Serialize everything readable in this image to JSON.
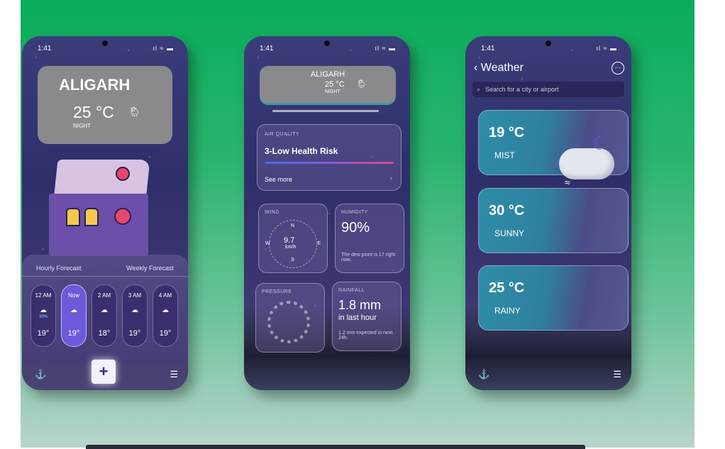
{
  "phone1": {
    "status": {
      "time": "1:41",
      "icons": "ıl ≈ ▬"
    },
    "card": {
      "city": "ALIGARH",
      "temp": "25 °C",
      "period": "NIGHT",
      "weather_icon": "🌦"
    },
    "forecast": {
      "tabs": [
        "Hourly Forecast",
        "Weekly Forecast"
      ],
      "hours": [
        {
          "label": "12 AM",
          "icon": "☁",
          "pct": "30%",
          "temp": "19°"
        },
        {
          "label": "Now",
          "icon": "☁",
          "pct": "",
          "temp": "19°"
        },
        {
          "label": "2 AM",
          "icon": "☁",
          "pct": "",
          "temp": "18°"
        },
        {
          "label": "3 AM",
          "icon": "☁",
          "pct": "",
          "temp": "19°"
        },
        {
          "label": "4 AM",
          "icon": "☁",
          "pct": "",
          "temp": "19°"
        }
      ]
    },
    "tabbar": {
      "left_icon": "⚓",
      "add_label": "+",
      "right_icon": "☰"
    }
  },
  "phone2": {
    "status": {
      "time": "1:41",
      "icons": "ıl ≈ ▬"
    },
    "card": {
      "city": "ALIGARH",
      "temp": "25 °C",
      "period": "NIGHT",
      "weather_icon": "🌦"
    },
    "air_quality": {
      "label": "AIR QUALITY",
      "value": "3-Low Health Risk",
      "more": "See more",
      "chevron": "›"
    },
    "wind": {
      "label": "WIND",
      "speed": "9.7",
      "unit": "km/h",
      "n": "N",
      "s": "S",
      "e": "E",
      "w": "W"
    },
    "humidity": {
      "label": "HUMIDITY",
      "value": "90%",
      "desc": "The dew point is 17 right now."
    },
    "pressure": {
      "label": "PRESSURE"
    },
    "rainfall": {
      "label": "RAINFALL",
      "value": "1.8 mm",
      "sub": "in last hour",
      "desc": "1.2 mm expected in next 24h."
    }
  },
  "phone3": {
    "status": {
      "time": "1:41",
      "icons": "ıl ≈ ▬"
    },
    "header": {
      "back_label": "‹ Weather",
      "more": "···"
    },
    "search": {
      "placeholder": "Search for a city or airport",
      "icon": "⌕"
    },
    "cards": [
      {
        "temp": "19 °C",
        "condition": "MIST"
      },
      {
        "temp": "30 °C",
        "condition": "SUNNY"
      },
      {
        "temp": "25 °C",
        "condition": "RAINY"
      }
    ],
    "tabbar": {
      "left_icon": "⚓",
      "right_icon": "☰"
    }
  },
  "colors": {
    "background": "#09ad5a",
    "phone": "#2e2f6a",
    "accent": "#6c5ad9",
    "card_teal": "#2e8ea7"
  }
}
